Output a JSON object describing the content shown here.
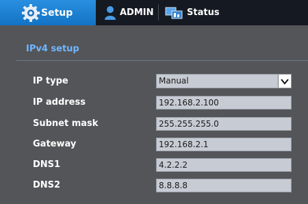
{
  "tabs": {
    "setup": {
      "label": "Setup",
      "icon": "gear-icon",
      "active": true
    },
    "admin": {
      "label": "ADMIN",
      "icon": "user-icon"
    },
    "status": {
      "label": "Status",
      "icon": "monitor-icon"
    }
  },
  "section": {
    "title": "IPv4 setup"
  },
  "form": {
    "ip_type": {
      "label": "IP type",
      "value": "Manual"
    },
    "ip_address": {
      "label": "IP address",
      "value": "192.168.2.100"
    },
    "subnet_mask": {
      "label": "Subnet mask",
      "value": "255.255.255.0"
    },
    "gateway": {
      "label": "Gateway",
      "value": "192.168.2.1"
    },
    "dns1": {
      "label": "DNS1",
      "value": "4.2.2.2"
    },
    "dns2": {
      "label": "DNS2",
      "value": "8.8.8.8"
    }
  },
  "colors": {
    "active_tab": "#1f82d6",
    "topbar": "#151a22",
    "background": "#545559",
    "section_title": "#6fb6ff"
  }
}
